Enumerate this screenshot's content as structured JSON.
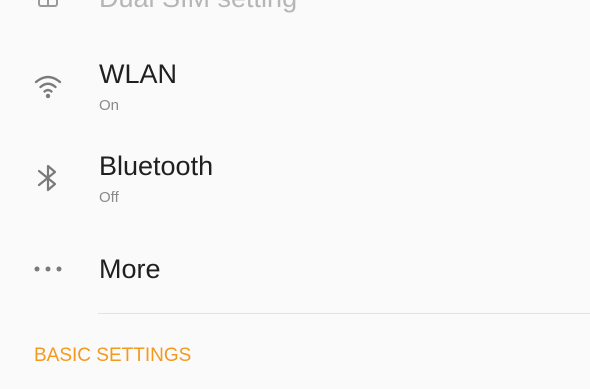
{
  "connections": {
    "dual_sim": {
      "title": "Dual SIM setting",
      "icon": "sim-card-icon"
    },
    "wlan": {
      "title": "WLAN",
      "status": "On",
      "icon": "wifi-icon"
    },
    "bluetooth": {
      "title": "Bluetooth",
      "status": "Off",
      "icon": "bluetooth-icon"
    },
    "more": {
      "title": "More",
      "icon": "more-horizontal-icon"
    }
  },
  "basic_settings": {
    "header": "BASIC SETTINGS"
  },
  "colors": {
    "accent": "#f39a1e",
    "title_text": "#202020",
    "secondary_text": "#8a8a8a",
    "icon": "#7a7a7a",
    "background": "#fafafa",
    "divider": "#e2e2e2"
  }
}
